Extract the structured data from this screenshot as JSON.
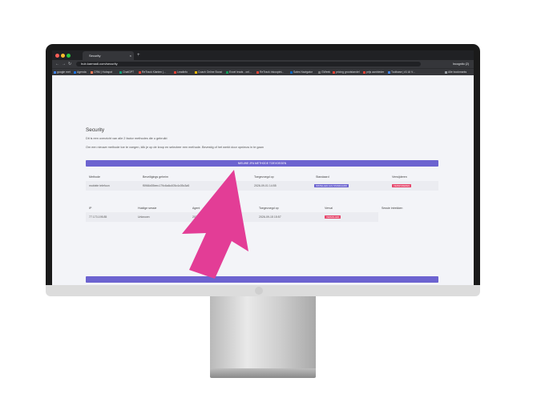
{
  "browser": {
    "tab_title": "Security",
    "tab_close": "×",
    "new_tab": "+",
    "url": "hub.karmadi.com/security",
    "incognito_label": "Incognito (2)",
    "nav_back": "←",
    "nav_forward": "→",
    "nav_reload": "↻",
    "bookmarks": [
      {
        "label": "google met",
        "color": "#4285f4"
      },
      {
        "label": "Agenda",
        "color": "#1a73e8"
      },
      {
        "label": "CRM | Hubspot",
        "color": "#ff7a59"
      },
      {
        "label": "ChatGPT",
        "color": "#10a37f"
      },
      {
        "label": "ReTrack Klanten |...",
        "color": "#e94235"
      },
      {
        "label": "Leadinfo",
        "color": "#e94235"
      },
      {
        "label": "Coach Online Boost",
        "color": "#fbbc05"
      },
      {
        "label": "Excel leads - onl...",
        "color": "#0f9d58"
      },
      {
        "label": "ReTrack Inkoopint...",
        "color": "#e94235"
      },
      {
        "label": "Sales Navigator",
        "color": "#0a66c2"
      },
      {
        "label": "GWeek",
        "color": "#777777"
      },
      {
        "label": "pricing grootstandel",
        "color": "#e94235"
      },
      {
        "label": "prijs aanbieder",
        "color": "#e94235"
      },
      {
        "label": "Toolbase | #1 AI V...",
        "color": "#4285f4"
      }
    ],
    "all_bookmarks": "Alle bookmarks"
  },
  "page": {
    "title": "Security",
    "intro": "Dit is een overzicht van alle 2 factor methodes die u gebruikt",
    "instruction": "Om een nieuwe methode toe te voegen, klik je op de knop en selecteer een methode. Bevestig of het werkt door opnieuw in te gaan",
    "add_button": "NIEUWE 2FA METHODE TOEVOEGEN",
    "methods_table": {
      "headers": [
        "Methode",
        "Beveiligings geheim",
        "Toegevoegd op",
        "Standaard",
        "Verwijderen"
      ],
      "row": {
        "method": "mobiele telefoon",
        "secret": "f5966d05eec179c6a6c405c4c05c3a5",
        "added": "2026-09-01 14:55",
        "default_badge": "INSTELLEN ALS STANDAARD",
        "delete_badge": "VERWIJDEREN"
      }
    },
    "sessions_table": {
      "headers": [
        "IP",
        "Huidige sessie",
        "Agent",
        "Toegevoegd op",
        "Verval",
        "Sessie intrekken"
      ],
      "row": {
        "ip": "77.173.195.85",
        "current": "Unknown",
        "agent": "2026-09-01 15:5",
        "added": "2026-09-15 15:57",
        "expire_badge": "VERVALLEN"
      }
    }
  },
  "colors": {
    "accent": "#6c63d0",
    "danger": "#e6456a",
    "arrow": "#e33d96"
  }
}
